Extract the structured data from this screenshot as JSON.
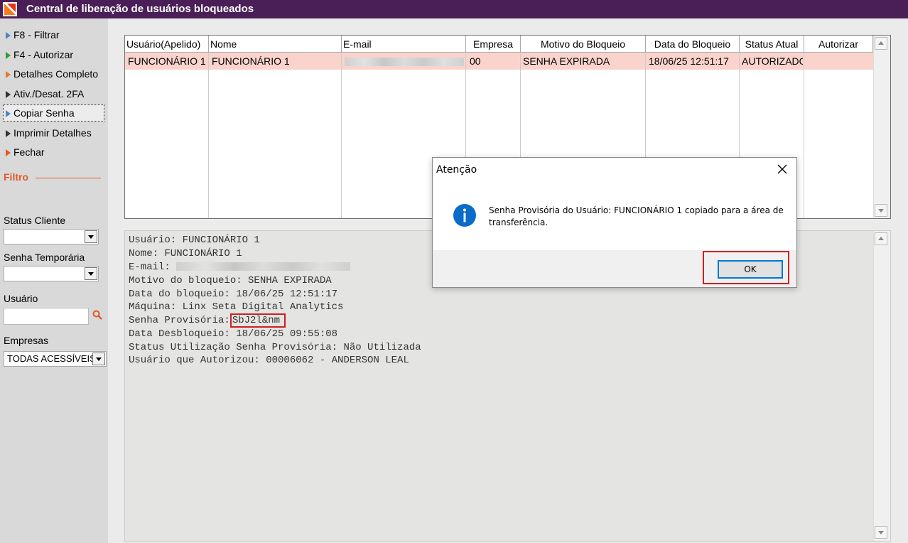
{
  "window": {
    "title": "Central de liberação de usuários bloqueados",
    "logo_icon": "app-logo-icon"
  },
  "sidebar": {
    "menu": [
      {
        "label": "F8 - Filtrar",
        "icon": "play-arrow-icon",
        "color": "#4a86c8"
      },
      {
        "label": "F4 - Autorizar",
        "icon": "play-arrow-icon",
        "color": "#2e9e2e"
      },
      {
        "label": "Detalhes Completo",
        "icon": "play-arrow-icon",
        "color": "#e07a30"
      },
      {
        "label": "Ativ./Desat. 2FA",
        "icon": "play-arrow-icon",
        "color": "#333333"
      },
      {
        "label": "Copiar Senha",
        "icon": "play-arrow-icon",
        "color": "#4a86c8"
      },
      {
        "label": "Imprimir Detalhes",
        "icon": "play-arrow-icon",
        "color": "#333333"
      },
      {
        "label": "Fechar",
        "icon": "play-arrow-icon",
        "color": "#e05a25"
      }
    ],
    "filter": {
      "heading": "Filtro",
      "status_cliente_label": "Status Cliente",
      "status_cliente_value": "",
      "senha_temporaria_label": "Senha Temporária",
      "senha_temporaria_value": "",
      "usuario_label": "Usuário",
      "usuario_value": "",
      "empresas_label": "Empresas",
      "empresas_value": "TODAS ACESSÍVEIS"
    }
  },
  "grid": {
    "columns": [
      "Usuário(Apelido)",
      "Nome",
      "E-mail",
      "Empresa",
      "Motivo do Bloqueio",
      "Data do Bloqueio",
      "Status Atual",
      "Autorizar"
    ],
    "rows": [
      {
        "usuario": "FUNCIONÁRIO 1",
        "nome": "FUNCIONÁRIO 1",
        "email": "",
        "empresa": "00",
        "motivo": "SENHA EXPIRADA",
        "data": "18/06/25 12:51:17",
        "status": "AUTORIZADO",
        "autorizar": ""
      }
    ]
  },
  "details": {
    "usuario": "Usuário: FUNCIONÁRIO 1",
    "nome": "Nome: FUNCIONÁRIO 1",
    "email_label": "E-mail:",
    "motivo": "Motivo do bloqueio: SENHA EXPIRADA",
    "data_bloqueio": "Data do bloqueio: 18/06/25 12:51:17",
    "maquina": "Máquina: Linx Seta Digital Analytics",
    "senha_label": "Senha Provisória:",
    "senha_value": "SbJ2l&nm",
    "data_desbloqueio": "Data Desbloqueio: 18/06/25 09:55:08",
    "status_utilizacao": "Status Utilização Senha Provisória: Não Utilizada",
    "autorizou": "Usuário que Autorizou: 00006062 - ANDERSON LEAL"
  },
  "dialog": {
    "title": "Atenção",
    "message": "Senha Provisória do Usuário: FUNCIONÁRIO 1 copiado para a área de transferência.",
    "ok_label": "OK",
    "icon": "info-icon"
  },
  "colors": {
    "titlebar": "#4a1f57",
    "accent": "#e05a25",
    "selected_row": "#fad4cc",
    "highlight": "#d01f1f",
    "focus": "#0078d7"
  }
}
